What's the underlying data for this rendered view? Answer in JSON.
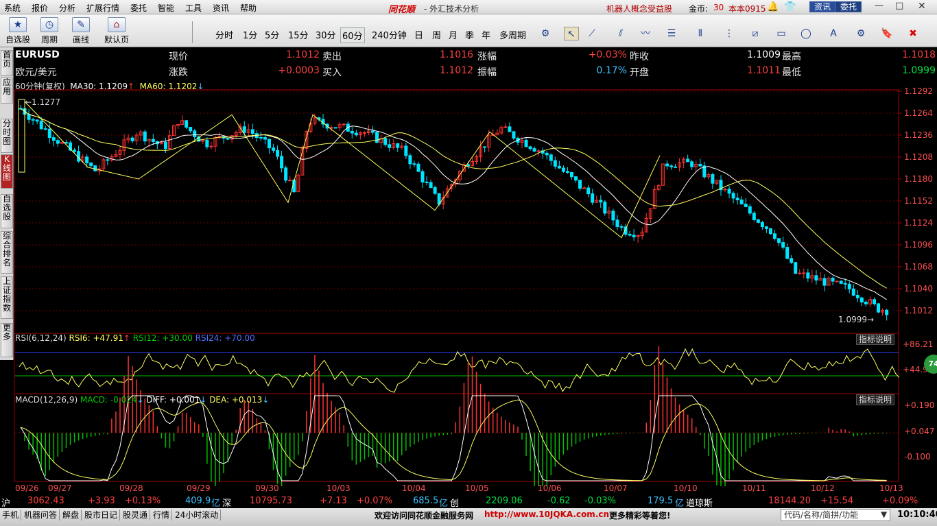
{
  "menu": [
    "系统",
    "报价",
    "分析",
    "扩展行情",
    "委托",
    "智能",
    "工具",
    "资讯",
    "帮助"
  ],
  "brand": "同花顺",
  "app_title": "- 外汇技术分析",
  "promo": "机器人概念受益股",
  "coins_label": "金币:",
  "coins_value": "30",
  "user": "本本0915",
  "btn_news": "资讯",
  "btn_trade": "委托",
  "toolbar": {
    "tools": [
      "自选股",
      "周期",
      "画线",
      "默认页"
    ],
    "periods": [
      "分时",
      "1分",
      "5分",
      "15分",
      "30分",
      "60分",
      "240分钟",
      "日",
      "周",
      "月",
      "季",
      "年",
      "多周期"
    ],
    "active_period": "60分"
  },
  "sidetabs": [
    "首页",
    "应用",
    "分时图",
    "K线图",
    "自选股",
    "综合排名",
    "上证指数",
    "更多"
  ],
  "header": {
    "symbol": "EURUSD",
    "name": "欧元/美元",
    "row1": [
      {
        "label": "现价",
        "value": "1.1012",
        "color": "r"
      },
      {
        "label": "卖出",
        "value": "1.1016",
        "color": "r"
      },
      {
        "label": "涨幅",
        "value": "+0.03%",
        "color": "r"
      },
      {
        "label": "昨收",
        "value": "1.1009",
        "color": "w"
      },
      {
        "label": "最高",
        "value": "1.1018",
        "color": "r"
      }
    ],
    "row2": [
      {
        "label": "涨跌",
        "value": "+0.0003",
        "color": "r"
      },
      {
        "label": "买入",
        "value": "1.1012",
        "color": "r"
      },
      {
        "label": "振幅",
        "value": "0.17%",
        "color": "c"
      },
      {
        "label": "开盘",
        "value": "1.1011",
        "color": "r"
      },
      {
        "label": "最低",
        "value": "1.0999",
        "color": "g"
      }
    ]
  },
  "ma_legend": {
    "prefix": "60分钟(复权)",
    "ma30": "MA30: 1.1209",
    "ma60": "MA60: 1.1202"
  },
  "price_axis": [
    "1.1292",
    "1.1264",
    "1.1236",
    "1.1208",
    "1.1180",
    "1.1152",
    "1.1124",
    "1.1096",
    "1.1068",
    "1.1040",
    "1.1012"
  ],
  "hi_mark": "1.1277",
  "lo_mark": "1.0999",
  "rsi_legend": {
    "name": "RSI(6,12,24)",
    "rsi6": "RSI6: +47.91",
    "rsi12": "RSI12: +30.00",
    "rsi24": "RSI24: +70.00"
  },
  "rsi_axis": [
    "+86.21",
    "+44.97"
  ],
  "macd_legend": {
    "name": "MACD(12,26,9)",
    "macd": "MACD: -0.024",
    "diff": "DIFF: +0.001",
    "dea": "DEA: +0.013"
  },
  "macd_axis": [
    "+0.190",
    "+0.047",
    "-0.100"
  ],
  "help": "指标说明",
  "badge": "74",
  "dates": [
    "09/26",
    "09/27",
    "09/28",
    "09/29",
    "09/30",
    "10/03",
    "10/04",
    "10/05",
    "10/06",
    "10/07",
    "10/10",
    "10/11",
    "10/12",
    "10/13"
  ],
  "ticker": {
    "sh_label": "沪",
    "sh_val": "3062.43",
    "sh_chg": "+3.93",
    "sh_pct": "+0.13%",
    "sh_amt": "409.9",
    "unit": "亿",
    "sz_label": "深",
    "sz_val": "10795.73",
    "sz_chg": "+7.13",
    "sz_pct": "+0.07%",
    "sz_amt": "685.5",
    "cy_label": "创",
    "cy_val": "2209.06",
    "cy_chg": "-0.62",
    "cy_pct": "-0.03%",
    "cy_amt": "179.5",
    "dj_label": "道琼斯",
    "dj_val": "18144.20",
    "dj_chg": "+15.54",
    "dj_pct": "+0.09%"
  },
  "status": {
    "items": [
      "手机",
      "机器问答",
      "解盘",
      "股市日记",
      "股灵通",
      "行情",
      "24小时滚动"
    ],
    "welcome": "欢迎访问同花顺金融服务网",
    "url": "http://www.10JQKA.com.cn",
    "more": "更多精彩等着您!",
    "search_placeholder": "代码/名称/简拼/功能",
    "clock": "10:10:40"
  },
  "colors": {
    "up": "#ff3232",
    "down": "#00e5ff",
    "ma30": "#ffffff",
    "ma60": "#ffff60",
    "rsi": "#ffff60",
    "macd_up": "#ff3232",
    "macd_dn": "#00c000"
  }
}
